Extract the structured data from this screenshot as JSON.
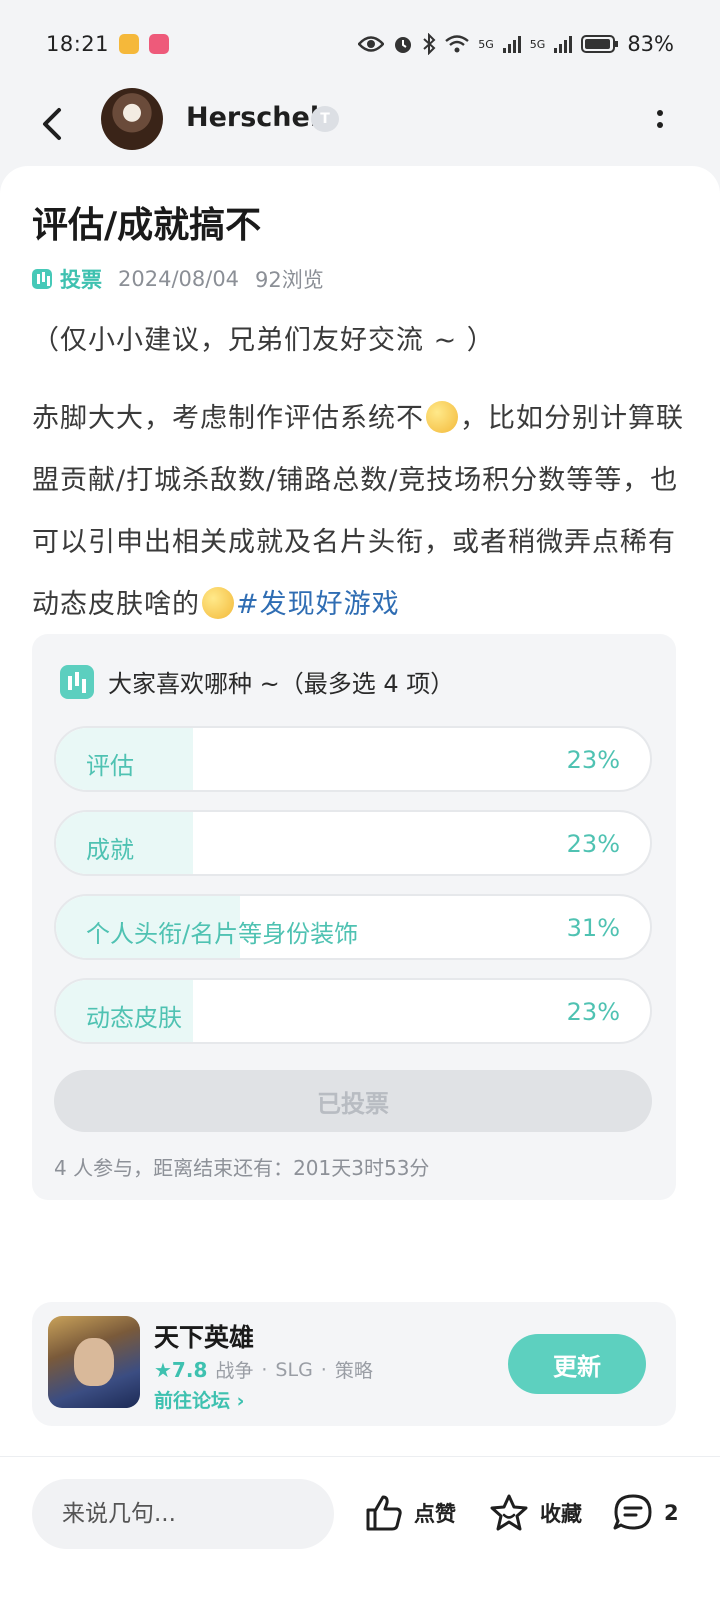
{
  "status_bar": {
    "time": "18:21",
    "battery": "83%",
    "network_1": "5G",
    "network_2": "5G"
  },
  "header": {
    "author": "Herschel",
    "level": "T"
  },
  "post": {
    "title": "评估/成就搞不",
    "type_tag": "投票",
    "date": "2024/08/04",
    "views": "92浏览",
    "intro": "（仅小小建议，兄弟们友好交流 ~ ）",
    "body_part1": "赤脚大大，考虑制作评估系统不",
    "body_part2": "，比如分别计算联盟贡献/打城杀敌数/铺路总数/竞技场积分数等等，也可以引申出相关成就及名片头衔，或者稍微弄点稀有动态皮肤啥的",
    "hashtag": "#发现好游戏"
  },
  "poll": {
    "question": "大家喜欢哪种 ~（最多选 4 项）",
    "options": [
      {
        "label": "评估",
        "percent": "23%",
        "value": 23
      },
      {
        "label": "成就",
        "percent": "23%",
        "value": 23
      },
      {
        "label": "个人头衔/名片等身份装饰",
        "percent": "31%",
        "value": 31
      },
      {
        "label": "动态皮肤",
        "percent": "23%",
        "value": 23
      }
    ],
    "voted_label": "已投票",
    "footer": "4 人参与，距离结束还有：201天3时53分"
  },
  "game": {
    "name": "天下英雄",
    "rating": "★7.8",
    "tags": [
      "战争",
      "SLG",
      "策略"
    ],
    "forum_link": "前往论坛 ›",
    "update_label": "更新"
  },
  "bottom_bar": {
    "comment_placeholder": "来说几句...",
    "like_label": "点赞",
    "favorite_label": "收藏",
    "comment_count": "2"
  },
  "colors": {
    "accent": "#4fc2b2",
    "hashtag": "#2f6db3",
    "button": "#5dd0bf"
  }
}
